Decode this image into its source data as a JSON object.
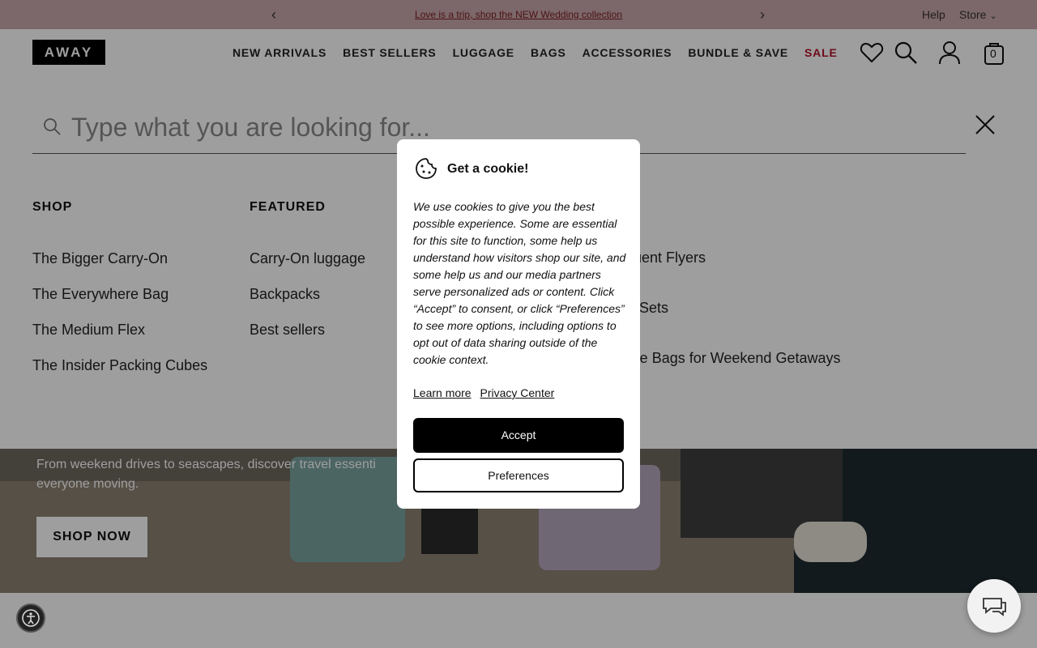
{
  "announcement": {
    "promo_text": "Love is a trip, shop the NEW Wedding collection",
    "help_label": "Help",
    "store_label": "Store",
    "store_chevron": "⌄"
  },
  "header": {
    "logo_text": "AWAY",
    "nav": [
      "NEW ARRIVALS",
      "BEST SELLERS",
      "LUGGAGE",
      "BAGS",
      "ACCESSORIES",
      "BUNDLE & SAVE",
      "SALE"
    ],
    "cart_count": "0"
  },
  "search": {
    "placeholder": "Type what you are looking for..."
  },
  "menu": {
    "shop": {
      "heading": "SHOP",
      "items": [
        "The Bigger Carry-On",
        "The Everywhere Bag",
        "The Medium Flex",
        "The Insider Packing Cubes"
      ]
    },
    "featured": {
      "heading": "FEATURED",
      "items": [
        "Carry-On luggage",
        "Backpacks",
        "Best sellers"
      ]
    },
    "third": {
      "items": [
        "quent Flyers",
        "Sets",
        "ffle Bags for Weekend Getaways"
      ]
    }
  },
  "hero": {
    "subtitle": "From weekend drives to seascapes, discover travel essenti everyone moving.",
    "cta": "SHOP NOW"
  },
  "cookie_modal": {
    "title": "Get a cookie!",
    "body": "We use cookies to give you the best possible experience. Some are essential for this site to function, some help us understand how visitors shop our site, and some help us and our media partners serve personalized ads or content. Click “Accept” to consent, or click “Preferences” to see more options, including options to opt out of data sharing outside of the cookie context.",
    "learn_more": "Learn more",
    "privacy_center": "Privacy Center",
    "accept": "Accept",
    "preferences": "Preferences"
  },
  "colors": {
    "announcement_bg": "#c9a6ac",
    "sale": "#b2122b",
    "accept_bg": "#000000"
  }
}
